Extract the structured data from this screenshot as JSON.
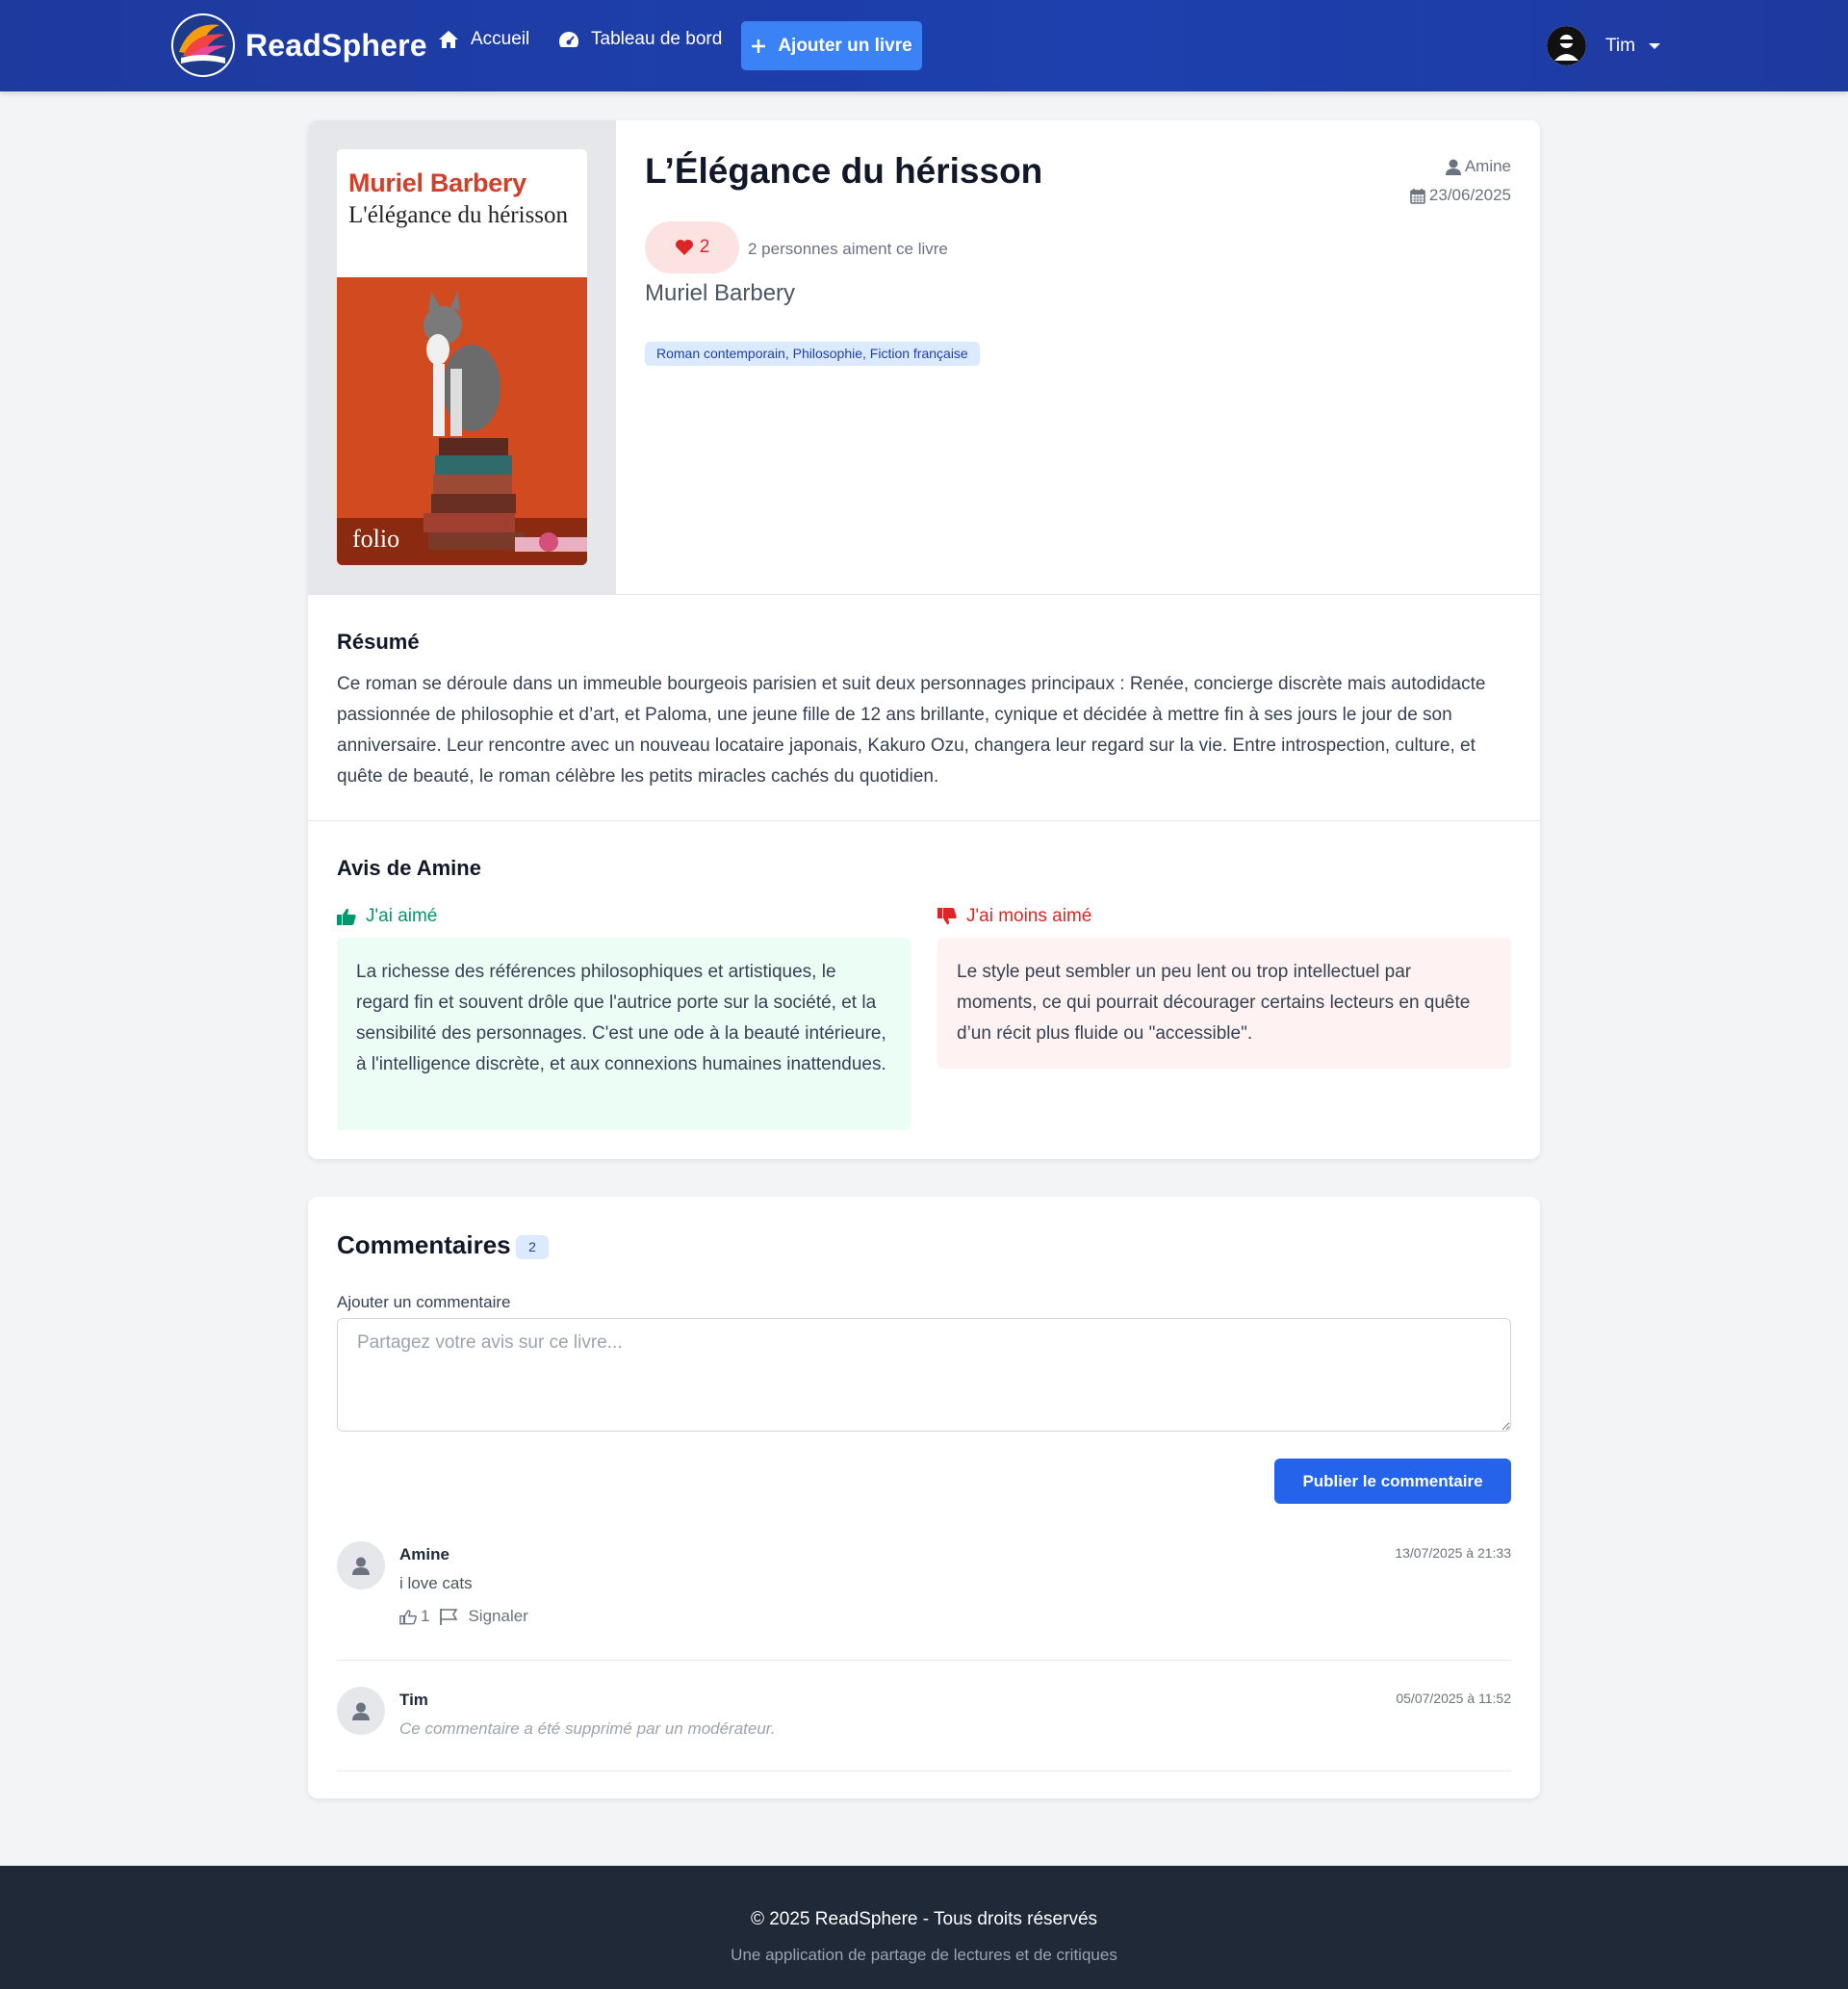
{
  "nav": {
    "brand": "ReadSphere",
    "home": "Accueil",
    "dashboard": "Tableau de bord",
    "add_book": "Ajouter un livre",
    "user": "Tim"
  },
  "book": {
    "cover_author": "Muriel Barbery",
    "cover_title": "L'élégance du hérisson",
    "cover_publisher": "folio",
    "title": "L’Élégance du hérisson",
    "owner": "Amine",
    "date": "23/06/2025",
    "likes": "2",
    "likes_text": "2 personnes aiment ce livre",
    "author": "Muriel Barbery",
    "genres": "Roman contemporain, Philosophie, Fiction française"
  },
  "summary": {
    "title": "Résumé",
    "text": "Ce roman se déroule dans un immeuble bourgeois parisien et suit deux personnages principaux : Renée, concierge discrète mais autodidacte passionnée de philosophie et d’art, et Paloma, une jeune fille de 12 ans brillante, cynique et décidée à mettre fin à ses jours le jour de son anniversaire. Leur rencontre avec un nouveau locataire japonais, Kakuro Ozu, changera leur regard sur la vie. Entre introspection, culture, et quête de beauté, le roman célèbre les petits miracles cachés du quotidien."
  },
  "review": {
    "title": "Avis de Amine",
    "liked_label": "J'ai aimé",
    "liked_text": "La richesse des références philosophiques et artistiques, le regard fin et souvent drôle que l'autrice porte sur la société, et la sensibilité des personnages. C'est une ode à la beauté intérieure, à l'intelligence discrète, et aux connexions humaines inattendues.",
    "disliked_label": "J'ai moins aimé",
    "disliked_text": "Le style peut sembler un peu lent ou trop intellectuel par moments, ce qui pourrait décourager certains lecteurs en quête d’un récit plus fluide ou \"accessible\"."
  },
  "comments": {
    "title": "Commentaires",
    "count": "2",
    "add_label": "Ajouter un commentaire",
    "placeholder": "Partagez votre avis sur ce livre...",
    "publish": "Publier le commentaire",
    "items": [
      {
        "author": "Amine",
        "date": "13/07/2025 à 21:33",
        "text": "i love cats",
        "likes": "1",
        "report": "Signaler"
      },
      {
        "author": "Tim",
        "date": "05/07/2025 à 11:52",
        "text": "Ce commentaire a été supprimé par un modérateur."
      }
    ]
  },
  "footer": {
    "copyright": "© 2025 ReadSphere - Tous droits réservés",
    "tagline": "Une application de partage de lectures et de critiques"
  },
  "colors": {
    "navbar": "#1e3a9f",
    "accent": "#3b82f6",
    "like": "#dc2626",
    "positive": "#059669",
    "footer": "#1f2937"
  }
}
